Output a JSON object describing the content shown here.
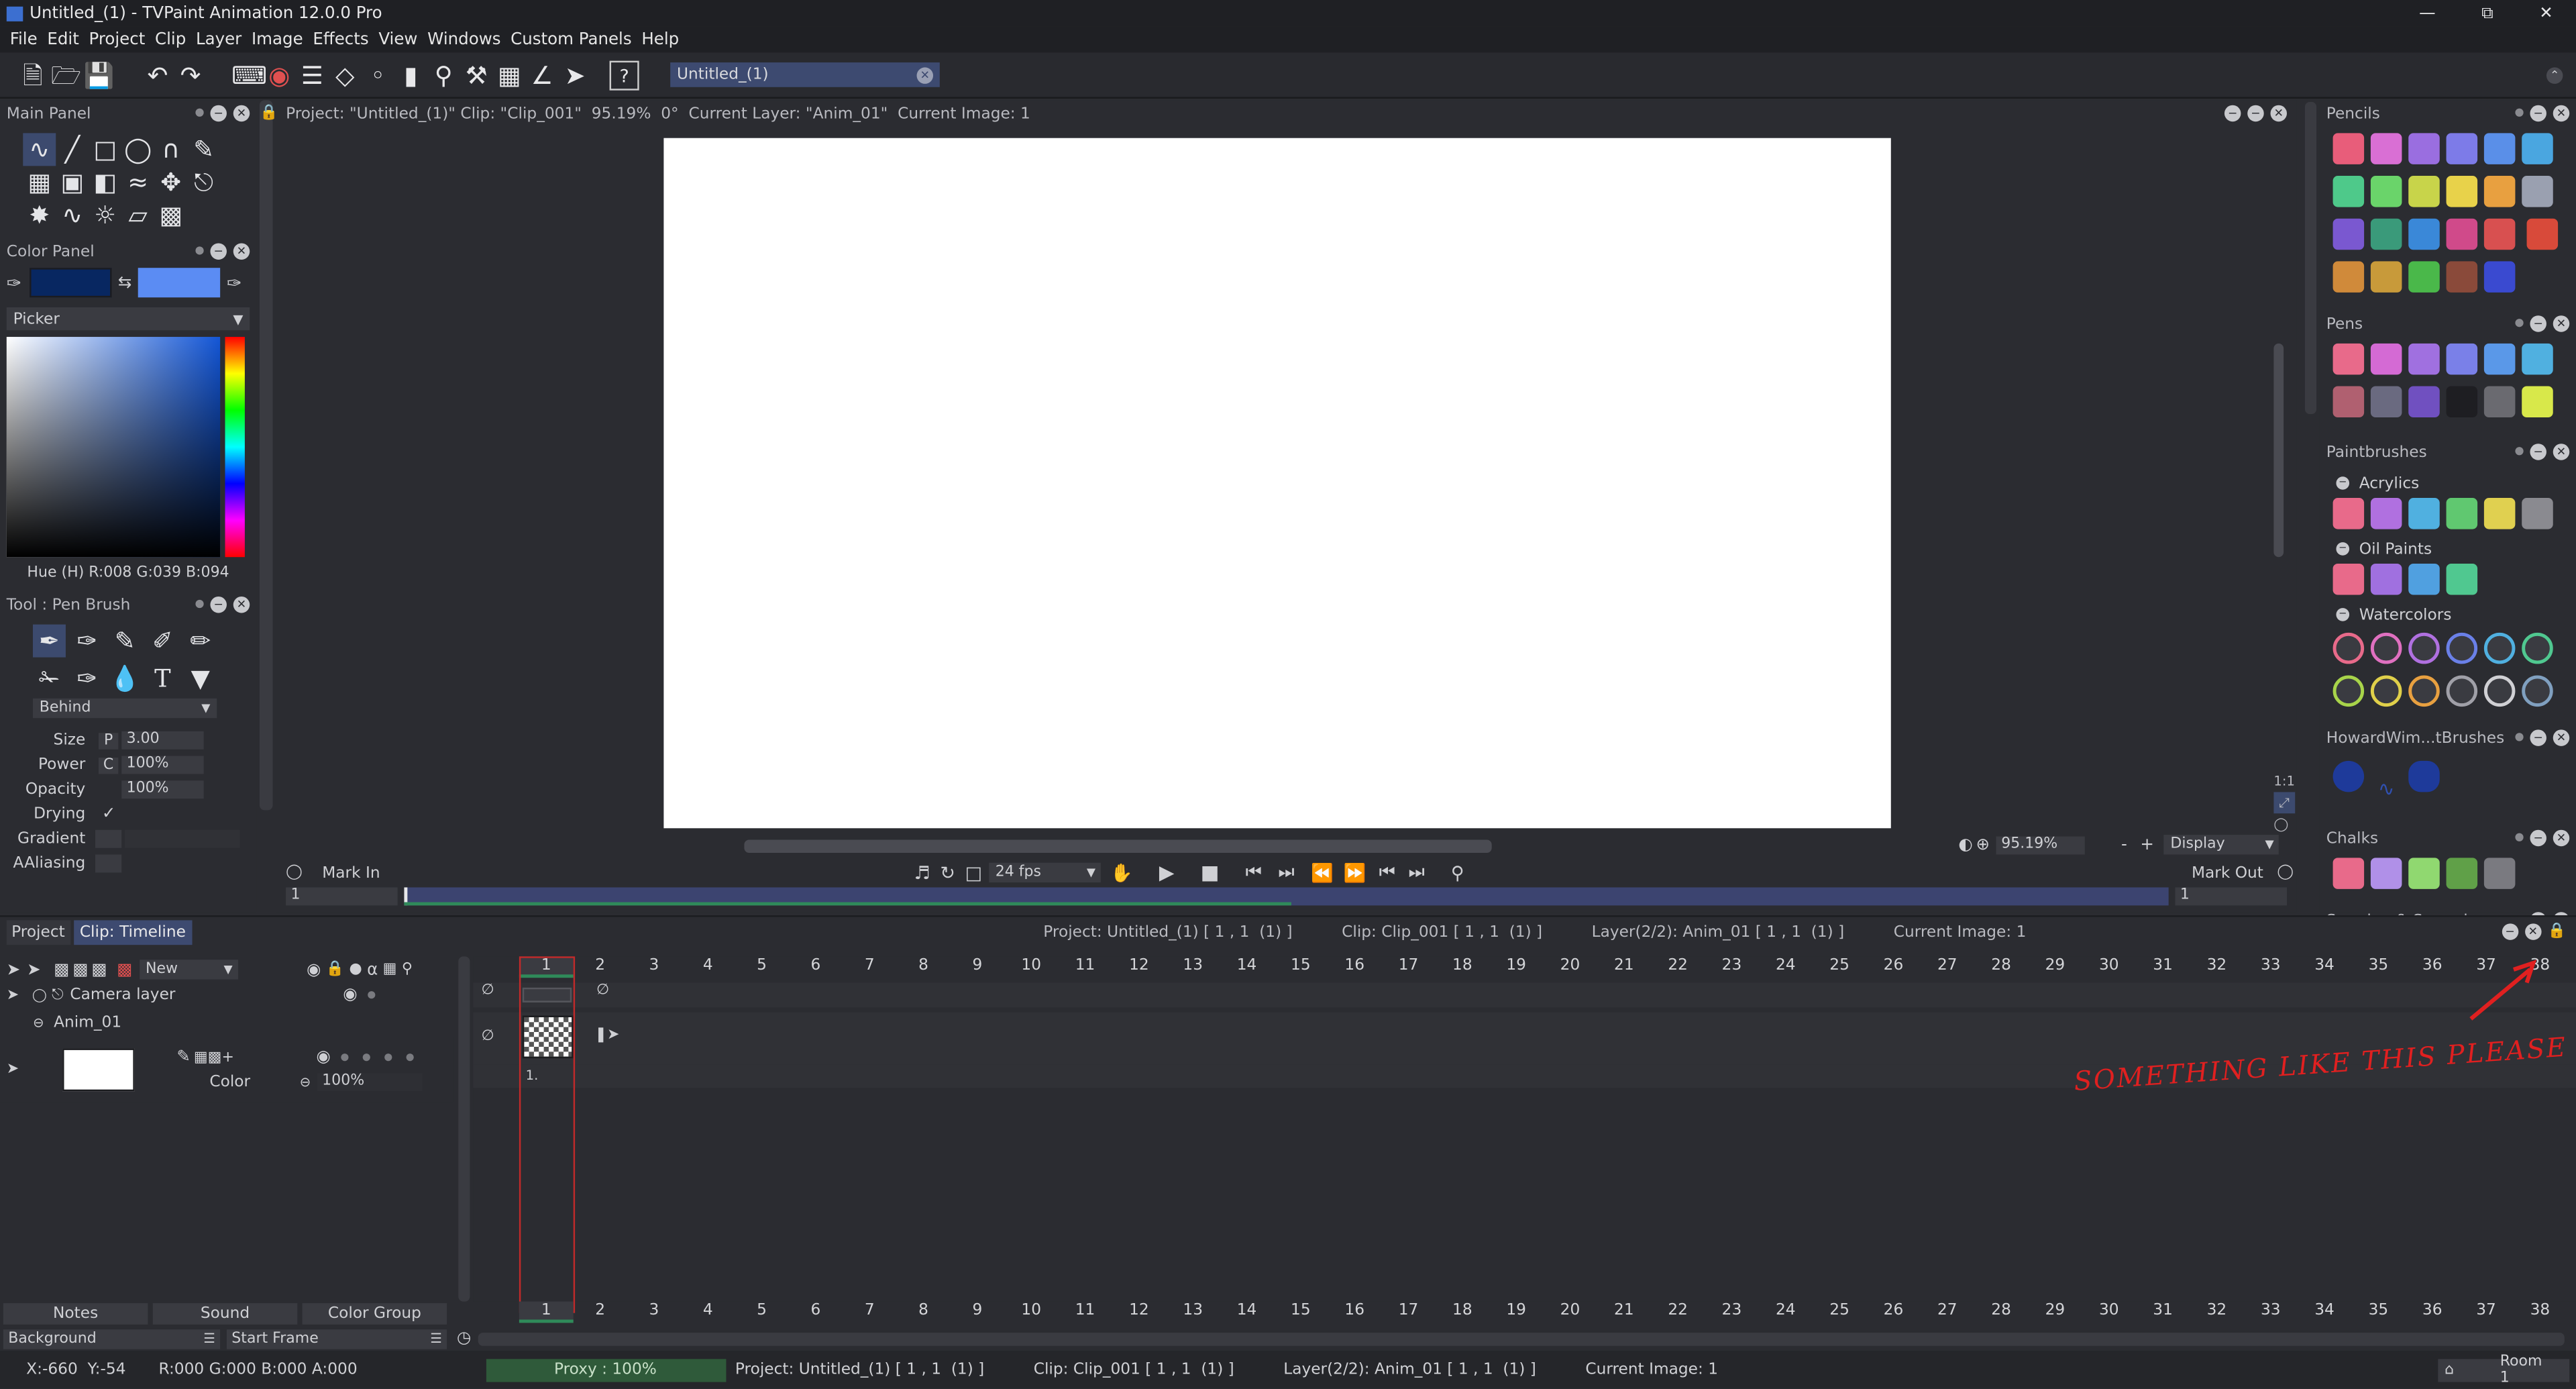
{
  "window": {
    "title": "Untitled_(1) - TVPaint Animation 12.0.0 Pro"
  },
  "menu": [
    "File",
    "Edit",
    "Project",
    "Clip",
    "Layer",
    "Image",
    "Effects",
    "View",
    "Windows",
    "Custom Panels",
    "Help"
  ],
  "toolbar": {
    "project_tab": "Untitled_(1)"
  },
  "main_panel": {
    "title": "Main Panel"
  },
  "color_panel": {
    "title": "Color Panel",
    "picker_label": "Picker",
    "hue_readout": "Hue (H) R:008 G:039 B:094",
    "primary_color": "#082761",
    "secondary_color": "#5b8cf3"
  },
  "tool_panel": {
    "title": "Tool : Pen Brush",
    "mode": "Behind",
    "params": [
      {
        "label": "Size",
        "prefix": "P",
        "value": "3.00"
      },
      {
        "label": "Power",
        "prefix": "C",
        "value": "100%"
      },
      {
        "label": "Opacity",
        "prefix": "",
        "value": "100%"
      }
    ],
    "drying_label": "Drying",
    "gradient_label": "Gradient",
    "aaliasing_label": "AAliasing"
  },
  "canvas": {
    "info": "Project: \"Untitled_(1)\" Clip: \"Clip_001\"  95.19%  0°  Current Layer: \"Anim_01\"  Current Image: 1",
    "zoom": "95.19%",
    "display_label": "Display",
    "fps": "24 fps",
    "mark_in_label": "Mark In",
    "mark_out_label": "Mark Out",
    "mark_in_value": "1",
    "mark_out_value": "1"
  },
  "right_panels": {
    "pencils": "Pencils",
    "pens": "Pens",
    "paintbrushes": "Paintbrushes",
    "acrylics": "Acrylics",
    "oil_paints": "Oil Paints",
    "watercolors": "Watercolors",
    "howard": "HowardWim...tBrushes",
    "chalks": "Chalks",
    "smudge": "Smudge & Spread"
  },
  "timeline": {
    "tab_project": "Project",
    "tab_clip": "Clip: Timeline",
    "info_project": "Project: Untitled_(1) [ 1 , 1  (1) ]",
    "info_clip": "Clip: Clip_001 [ 1 , 1  (1) ]",
    "info_layer": "Layer(2/2): Anim_01 [ 1 , 1  (1) ]",
    "info_image": "Current Image: 1",
    "new_label": "New",
    "camera_layer": "Camera layer",
    "anim_layer": "Anim_01",
    "color_label": "Color",
    "opacity": "100%",
    "frame_marker": "1.",
    "frames": [
      "1",
      "2",
      "3",
      "4",
      "5",
      "6",
      "7",
      "8",
      "9",
      "10",
      "11",
      "12",
      "13",
      "14",
      "15",
      "16",
      "17",
      "18",
      "19",
      "20",
      "21",
      "22",
      "23",
      "24",
      "25",
      "26",
      "27",
      "28",
      "29",
      "30",
      "31",
      "32",
      "33",
      "34",
      "35",
      "36",
      "37",
      "38",
      "3"
    ],
    "btn_notes": "Notes",
    "btn_sound": "Sound",
    "btn_color_group": "Color Group",
    "background_label": "Background",
    "start_frame_label": "Start Frame"
  },
  "annotation": "SOMETHING LIKE THIS PLEASE",
  "status": {
    "coords": "X:-660  Y:-54",
    "rgba": "R:000 G:000 B:000 A:000",
    "proxy": "Proxy : 100%",
    "project": "Project: Untitled_(1) [ 1 , 1  (1) ]",
    "clip": "Clip: Clip_001 [ 1 , 1  (1) ]",
    "layer": "Layer(2/2): Anim_01 [ 1 , 1  (1) ]",
    "image": "Current Image: 1",
    "room": "Room 1"
  }
}
